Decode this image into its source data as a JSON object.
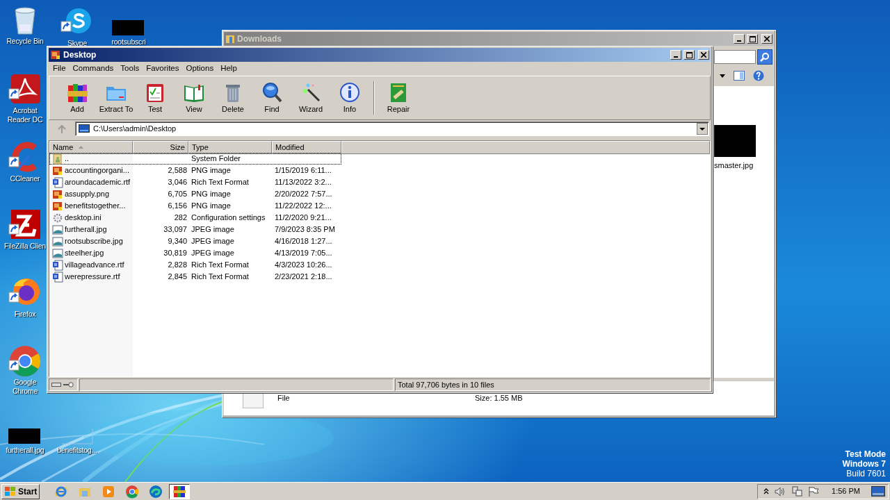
{
  "desktop_icons": [
    {
      "label": "Recycle Bin",
      "kind": "recycle",
      "shortcut": false
    },
    {
      "label": "Skype",
      "kind": "skype",
      "shortcut": true
    },
    {
      "label": "rootsubscri",
      "kind": "thumbnail",
      "shortcut": false
    },
    {
      "label": "Acrobat Reader DC",
      "kind": "acrobat",
      "shortcut": true
    },
    {
      "label": "CCleaner",
      "kind": "ccleaner",
      "shortcut": true
    },
    {
      "label": "FileZilla Clien",
      "kind": "filezilla",
      "shortcut": true
    },
    {
      "label": "Firefox",
      "kind": "firefox",
      "shortcut": true
    },
    {
      "label": "Google Chrome",
      "kind": "chrome",
      "shortcut": true
    },
    {
      "label": "furtherall.jpg",
      "kind": "thumbnail",
      "shortcut": false
    },
    {
      "label": "benefitstog...",
      "kind": "blank",
      "shortcut": false
    }
  ],
  "downloads_window": {
    "title": "Downloads",
    "active": false,
    "item_label": "smaster.jpg",
    "details": {
      "type": "File",
      "size": "Size: 1.55 MB"
    }
  },
  "winrar_window": {
    "title": "Desktop",
    "active": true,
    "menu": [
      "File",
      "Commands",
      "Tools",
      "Favorites",
      "Options",
      "Help"
    ],
    "toolbar": [
      {
        "label": "Add",
        "kind": "add"
      },
      {
        "label": "Extract To",
        "kind": "extract"
      },
      {
        "label": "Test",
        "kind": "test"
      },
      {
        "label": "View",
        "kind": "view"
      },
      {
        "label": "Delete",
        "kind": "delete"
      },
      {
        "label": "Find",
        "kind": "find"
      },
      {
        "label": "Wizard",
        "kind": "wizard"
      },
      {
        "label": "Info",
        "kind": "info"
      },
      {
        "label": "Repair",
        "kind": "repair"
      }
    ],
    "address": "C:\\Users\\admin\\Desktop",
    "columns": [
      {
        "label": "Name",
        "sorted": true
      },
      {
        "label": "Size",
        "sorted": false
      },
      {
        "label": "Type",
        "sorted": false
      },
      {
        "label": "Modified",
        "sorted": false
      }
    ],
    "rows": [
      {
        "name": "..",
        "size": "",
        "type": "System Folder",
        "modified": "",
        "kind": "folder",
        "selected": true
      },
      {
        "name": "accountingorgani...",
        "size": "2,588",
        "type": "PNG image",
        "modified": "1/15/2019 6:11...",
        "kind": "png",
        "selected": false
      },
      {
        "name": "aroundacademic.rtf",
        "size": "3,046",
        "type": "Rich Text Format",
        "modified": "11/13/2022 3:2...",
        "kind": "rtf",
        "selected": false
      },
      {
        "name": "assupply.png",
        "size": "6,705",
        "type": "PNG image",
        "modified": "2/20/2022 7:57...",
        "kind": "png",
        "selected": false
      },
      {
        "name": "benefitstogether...",
        "size": "6,156",
        "type": "PNG image",
        "modified": "11/22/2022 12:...",
        "kind": "png",
        "selected": false
      },
      {
        "name": "desktop.ini",
        "size": "282",
        "type": "Configuration settings",
        "modified": "11/2/2020 9:21...",
        "kind": "ini",
        "selected": false
      },
      {
        "name": "furtherall.jpg",
        "size": "33,097",
        "type": "JPEG image",
        "modified": "7/9/2023 8:35 PM",
        "kind": "jpg",
        "selected": false
      },
      {
        "name": "rootsubscribe.jpg",
        "size": "9,340",
        "type": "JPEG image",
        "modified": "4/16/2018 1:27...",
        "kind": "jpg",
        "selected": false
      },
      {
        "name": "steelher.jpg",
        "size": "30,819",
        "type": "JPEG image",
        "modified": "4/13/2019 7:05...",
        "kind": "jpg",
        "selected": false
      },
      {
        "name": "villageadvance.rtf",
        "size": "2,828",
        "type": "Rich Text Format",
        "modified": "4/3/2023 10:26...",
        "kind": "rtf",
        "selected": false
      },
      {
        "name": "werepressure.rtf",
        "size": "2,845",
        "type": "Rich Text Format",
        "modified": "2/23/2021 2:18...",
        "kind": "rtf",
        "selected": false
      }
    ],
    "status": "Total 97,706 bytes in 10 files"
  },
  "system_notice": [
    "Test Mode",
    "Windows 7",
    "Build 7601"
  ],
  "taskbar": {
    "start": "Start",
    "apps": [
      {
        "kind": "ie",
        "active": false
      },
      {
        "kind": "explorer",
        "active": false
      },
      {
        "kind": "media",
        "active": false
      },
      {
        "kind": "chrome",
        "active": false
      },
      {
        "kind": "edge",
        "active": false
      },
      {
        "kind": "winrar",
        "active": true
      }
    ],
    "clock": "1:56 PM"
  }
}
